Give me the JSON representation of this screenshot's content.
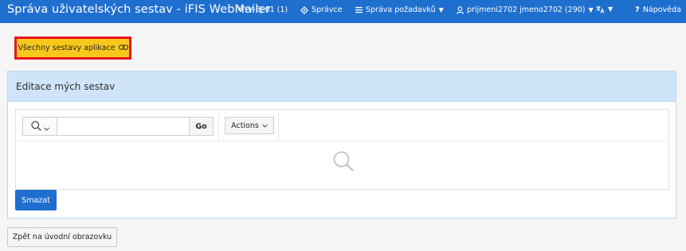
{
  "header": {
    "app_title": "Správa uživatelských sestav - iFIS WebMailer",
    "environment": "VYV-EJ-01 (1)",
    "admin_label": "Správce",
    "requests_label": "Správa požadavků",
    "user_label": "prijmeni2702 jmeno2702 (290)",
    "help_label": "Nápověda"
  },
  "toolbar_top": {
    "all_reports_label": "Všechny sestavy aplikace"
  },
  "region": {
    "title": "Editace mých sestav",
    "search": {
      "value": "",
      "placeholder": ""
    },
    "go_label": "Go",
    "actions_label": "Actions",
    "delete_label": "Smazat"
  },
  "footer": {
    "back_label": "Zpět na úvodní obrazovku"
  },
  "colors": {
    "navbar": "#1f6fcf",
    "highlight_fill": "#f7c81b",
    "highlight_border": "#e6141c",
    "region_header": "#cfe4f8"
  },
  "icons": {
    "admin": "gear-icon",
    "requests": "menu-lines-icon",
    "user": "user-icon",
    "language": "translate-icon",
    "help": "question-icon",
    "all_reports": "link-icon",
    "search_column": "search-icon",
    "empty_state": "search-icon"
  }
}
